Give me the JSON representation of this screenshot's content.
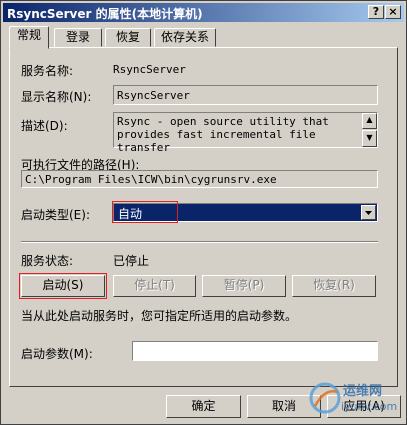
{
  "window": {
    "title": "RsyncServer 的属性(本地计算机)",
    "help_label": "?",
    "close_label": "×"
  },
  "tabs": [
    {
      "label": "常规"
    },
    {
      "label": "登录"
    },
    {
      "label": "恢复"
    },
    {
      "label": "依存关系"
    }
  ],
  "general": {
    "service_name_label": "服务名称:",
    "service_name_value": "RsyncServer",
    "display_name_label": "显示名称(N):",
    "display_name_value": "RsyncServer",
    "description_label": "描述(D):",
    "description_value": "Rsync - open source utility that provides fast incremental file transfer",
    "exe_path_label": "可执行文件的路径(H):",
    "exe_path_value": "C:\\Program Files\\ICW\\bin\\cygrunsrv.exe",
    "startup_type_label": "启动类型(E):",
    "startup_type_value": "自动",
    "service_status_label": "服务状态:",
    "service_status_value": "已停止",
    "start_button": "启动(S)",
    "stop_button": "停止(T)",
    "pause_button": "暂停(P)",
    "resume_button": "恢复(R)",
    "hint_text": "当从此处启动服务时，您可指定所适用的启动参数。",
    "start_params_label": "启动参数(M):",
    "start_params_value": ""
  },
  "footer": {
    "ok_button": "确定",
    "cancel_button": "取消",
    "apply_button": "应用(A)"
  },
  "watermark": {
    "text_cn": "运维网",
    "text_en": "iyunv.com"
  },
  "colors": {
    "highlight": "#0a246a",
    "annotation_red": "#e02020",
    "face": "#d4d0c8"
  }
}
